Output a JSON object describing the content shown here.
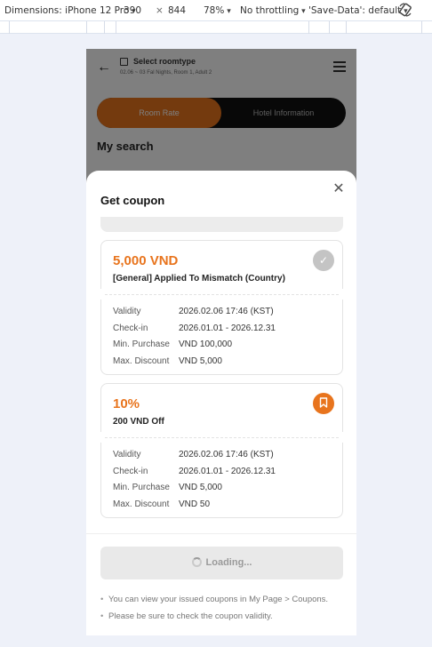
{
  "devtools": {
    "dimensions": "Dimensions: iPhone 12 Pro",
    "width": "390",
    "times": "×",
    "height": "844",
    "zoom": "78%",
    "throttling": "No throttling",
    "save_data": "'Save-Data': default"
  },
  "background": {
    "header_title": "Select roomtype",
    "header_sub": "02.06 ~ 03 Fal Nights, Room 1, Adult 2",
    "tab_active": "Room Rate",
    "tab_inactive": "Hotel Information",
    "section_title": "My search"
  },
  "sheet": {
    "title": "Get coupon",
    "close_symbol": "✕",
    "coupons": [
      {
        "value": "5,000 VND",
        "name": "[General] Applied To Mismatch (Country)",
        "status": "issued",
        "icon": "check-icon",
        "details": [
          {
            "label": "Validity",
            "value": "2026.02.06 17:46 (KST)"
          },
          {
            "label": "Check-in",
            "value": "2026.01.01 - 2026.12.31"
          },
          {
            "label": "Min. Purchase",
            "value": "VND 100,000"
          },
          {
            "label": "Max. Discount",
            "value": "VND 5,000"
          }
        ]
      },
      {
        "value": "10%",
        "name": "200 VND Off",
        "status": "available",
        "icon": "bookmark-icon",
        "details": [
          {
            "label": "Validity",
            "value": "2026.02.06 17:46 (KST)"
          },
          {
            "label": "Check-in",
            "value": "2026.01.01 - 2026.12.31"
          },
          {
            "label": "Min. Purchase",
            "value": "VND 5,000"
          },
          {
            "label": "Max. Discount",
            "value": "VND 50"
          }
        ]
      }
    ],
    "loading_label": "Loading...",
    "notes": [
      "You can view your issued coupons in My Page > Coupons.",
      "Please be sure to check the coupon validity."
    ]
  },
  "colors": {
    "accent": "#e8741d",
    "issued_icon": "#c4c4c4",
    "overlay": "rgba(0,0,0,0.5)"
  }
}
